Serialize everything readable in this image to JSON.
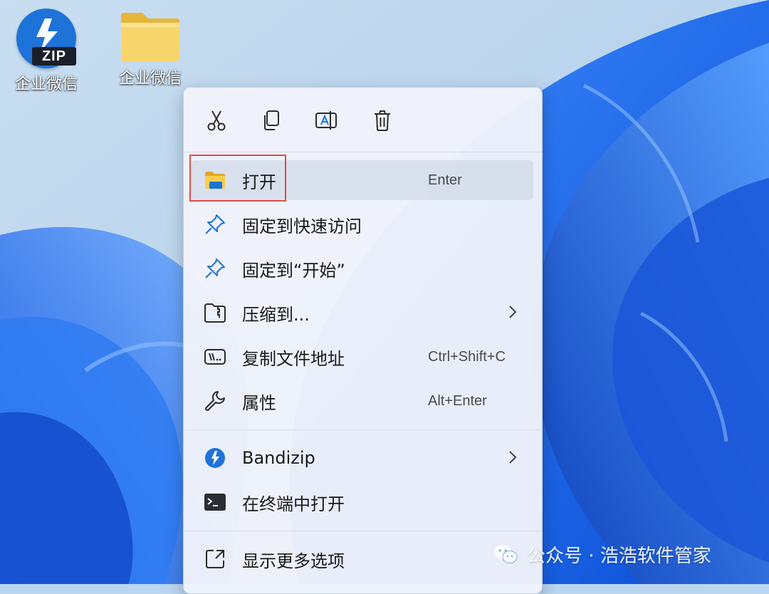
{
  "desktop": {
    "icons": [
      {
        "label": "企业微信",
        "type": "zip-archive"
      },
      {
        "label": "企业微信",
        "type": "folder"
      }
    ],
    "zip_badge": "ZIP"
  },
  "context_menu": {
    "toolbar": [
      {
        "icon": "cut-icon"
      },
      {
        "icon": "copy-icon"
      },
      {
        "icon": "rename-icon"
      },
      {
        "icon": "delete-icon"
      }
    ],
    "items": [
      {
        "label": "打开",
        "shortcut": "Enter",
        "icon": "folder-open-icon",
        "highlighted": true
      },
      {
        "label": "固定到快速访问",
        "shortcut": "",
        "icon": "pin-icon"
      },
      {
        "label": "固定到“开始”",
        "shortcut": "",
        "icon": "pin-icon"
      },
      {
        "label": "压缩到...",
        "shortcut": "",
        "icon": "compress-icon",
        "submenu": true
      },
      {
        "label": "复制文件地址",
        "shortcut": "Ctrl+Shift+C",
        "icon": "copy-path-icon"
      },
      {
        "label": "属性",
        "shortcut": "Alt+Enter",
        "icon": "wrench-icon"
      },
      {
        "label": "Bandizip",
        "shortcut": "",
        "icon": "bandizip-icon",
        "submenu": true
      },
      {
        "label": "在终端中打开",
        "shortcut": "",
        "icon": "terminal-icon"
      },
      {
        "label": "显示更多选项",
        "shortcut": "",
        "icon": "show-more-icon"
      }
    ]
  },
  "watermark": {
    "text": "公众号 · 浩浩软件管家"
  },
  "colors": {
    "accent": "#1e73d8",
    "highlight_border": "#e34a4a",
    "menu_bg": "#f0f3fa"
  }
}
